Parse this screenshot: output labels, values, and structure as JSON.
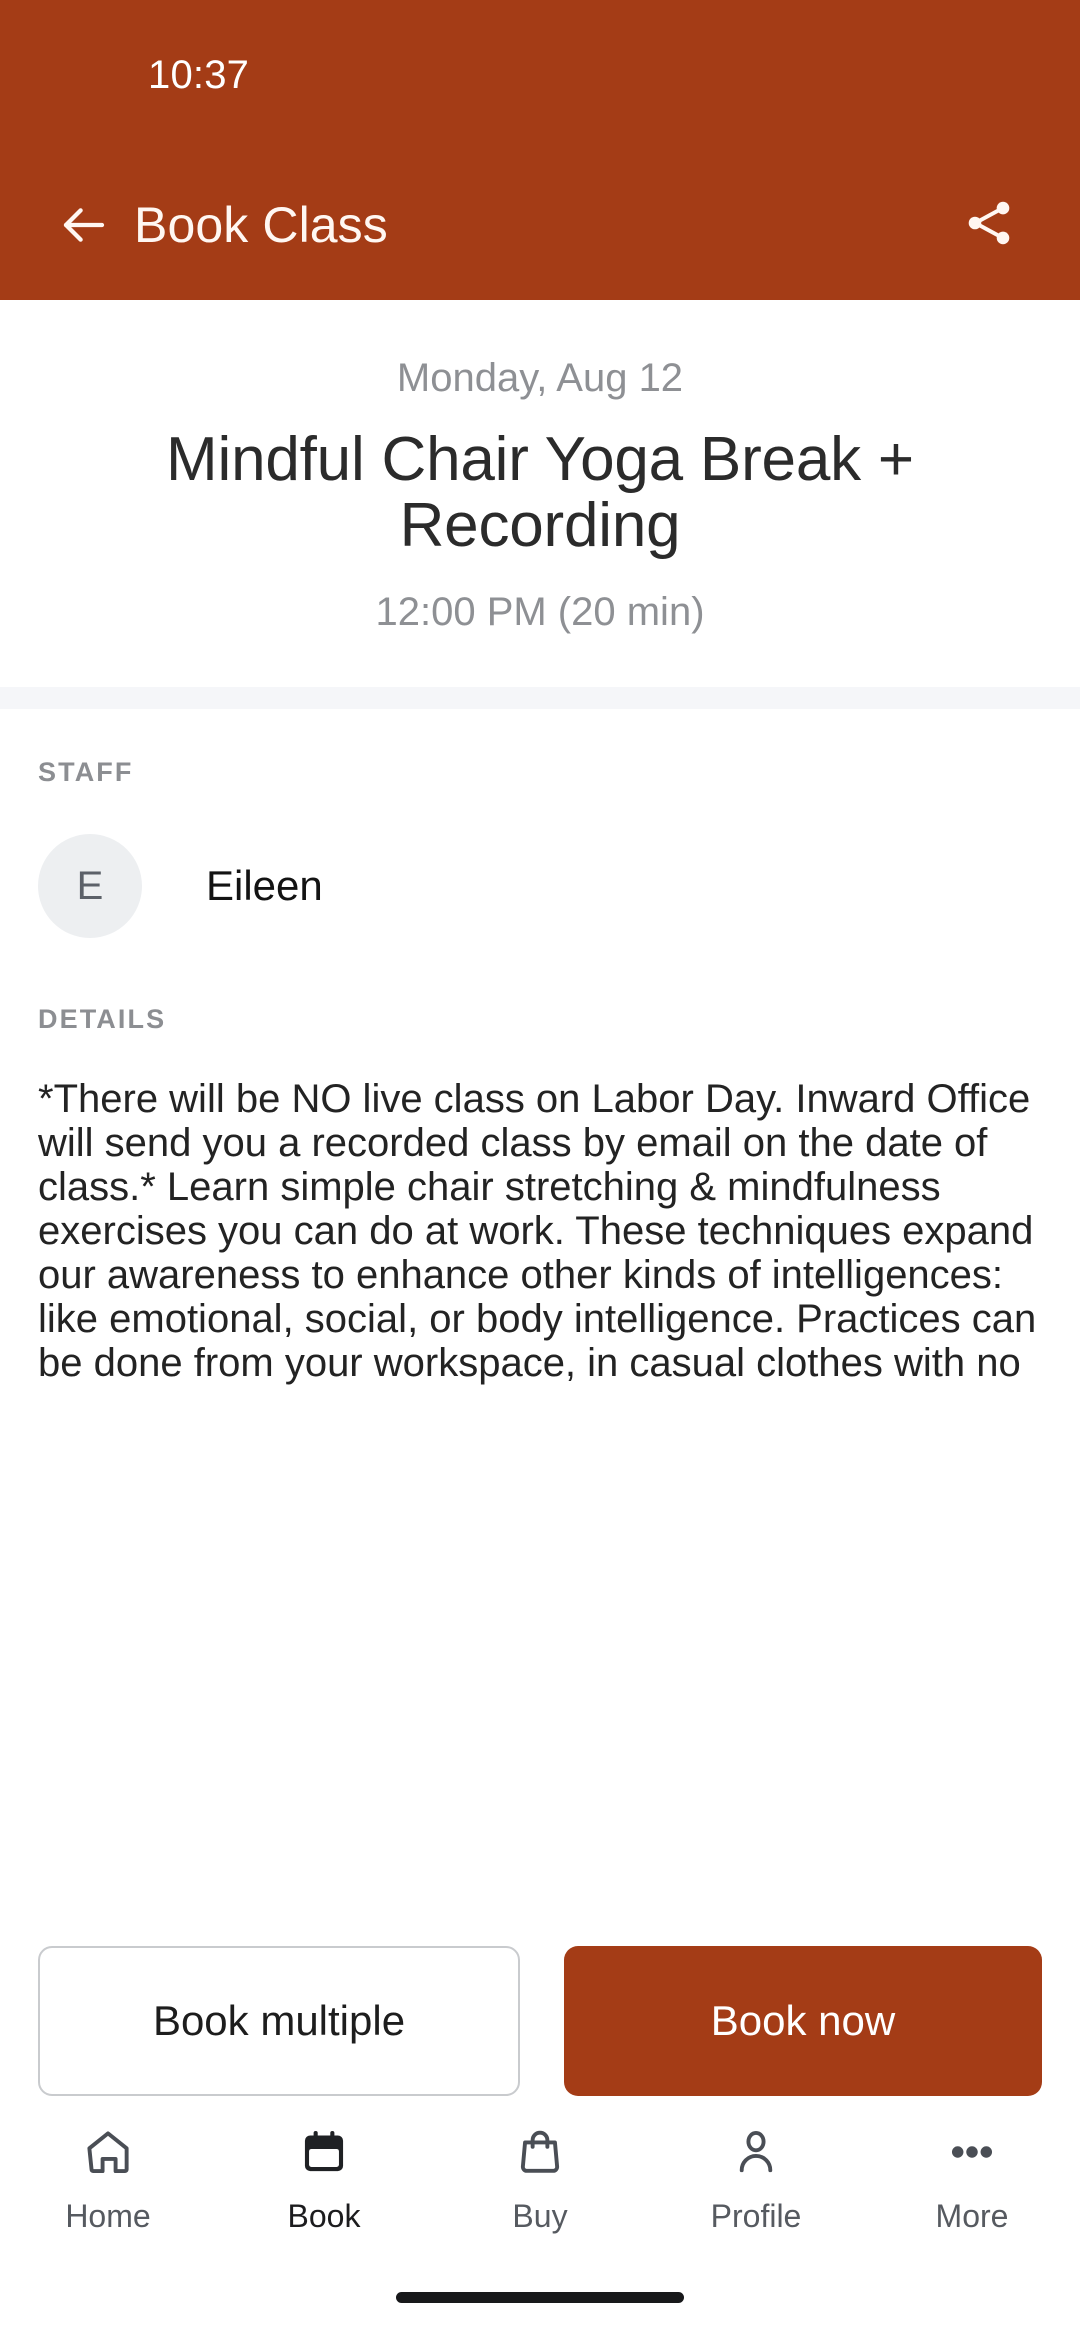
{
  "theme": {
    "accent": "#A43C16",
    "accent_text": "#FFF7F2",
    "muted_text": "#8E9094",
    "body_text": "#232323",
    "divider": "#F5F6F9"
  },
  "status_bar": {
    "time": "10:37"
  },
  "app_bar": {
    "back_icon": "arrow-left-icon",
    "title": "Book Class",
    "share_icon": "share-icon"
  },
  "class_header": {
    "date": "Monday, Aug 12",
    "title": "Mindful Chair Yoga Break + Recording",
    "time": "12:00 PM (20 min)"
  },
  "staff_section": {
    "label": "STAFF",
    "members": [
      {
        "initial": "E",
        "name": "Eileen"
      }
    ]
  },
  "details_section": {
    "label": "DETAILS",
    "text": "*There will be NO live class on Labor Day. Inward Office will send you a recorded class by email on the date of class.*   Learn simple chair stretching & mindfulness exercises you can do at work. These techniques expand our awareness to enhance other kinds of intelligences: like emotional, social, or body intelligence.    Practices can be done from your workspace, in casual clothes with no"
  },
  "actions": {
    "book_multiple_label": "Book multiple",
    "book_now_label": "Book now"
  },
  "bottom_nav": {
    "items": [
      {
        "label": "Home",
        "icon": "home-icon",
        "active": false
      },
      {
        "label": "Book",
        "icon": "calendar-icon",
        "active": true
      },
      {
        "label": "Buy",
        "icon": "bag-icon",
        "active": false
      },
      {
        "label": "Profile",
        "icon": "person-icon",
        "active": false
      },
      {
        "label": "More",
        "icon": "ellipsis-icon",
        "active": false
      }
    ]
  }
}
